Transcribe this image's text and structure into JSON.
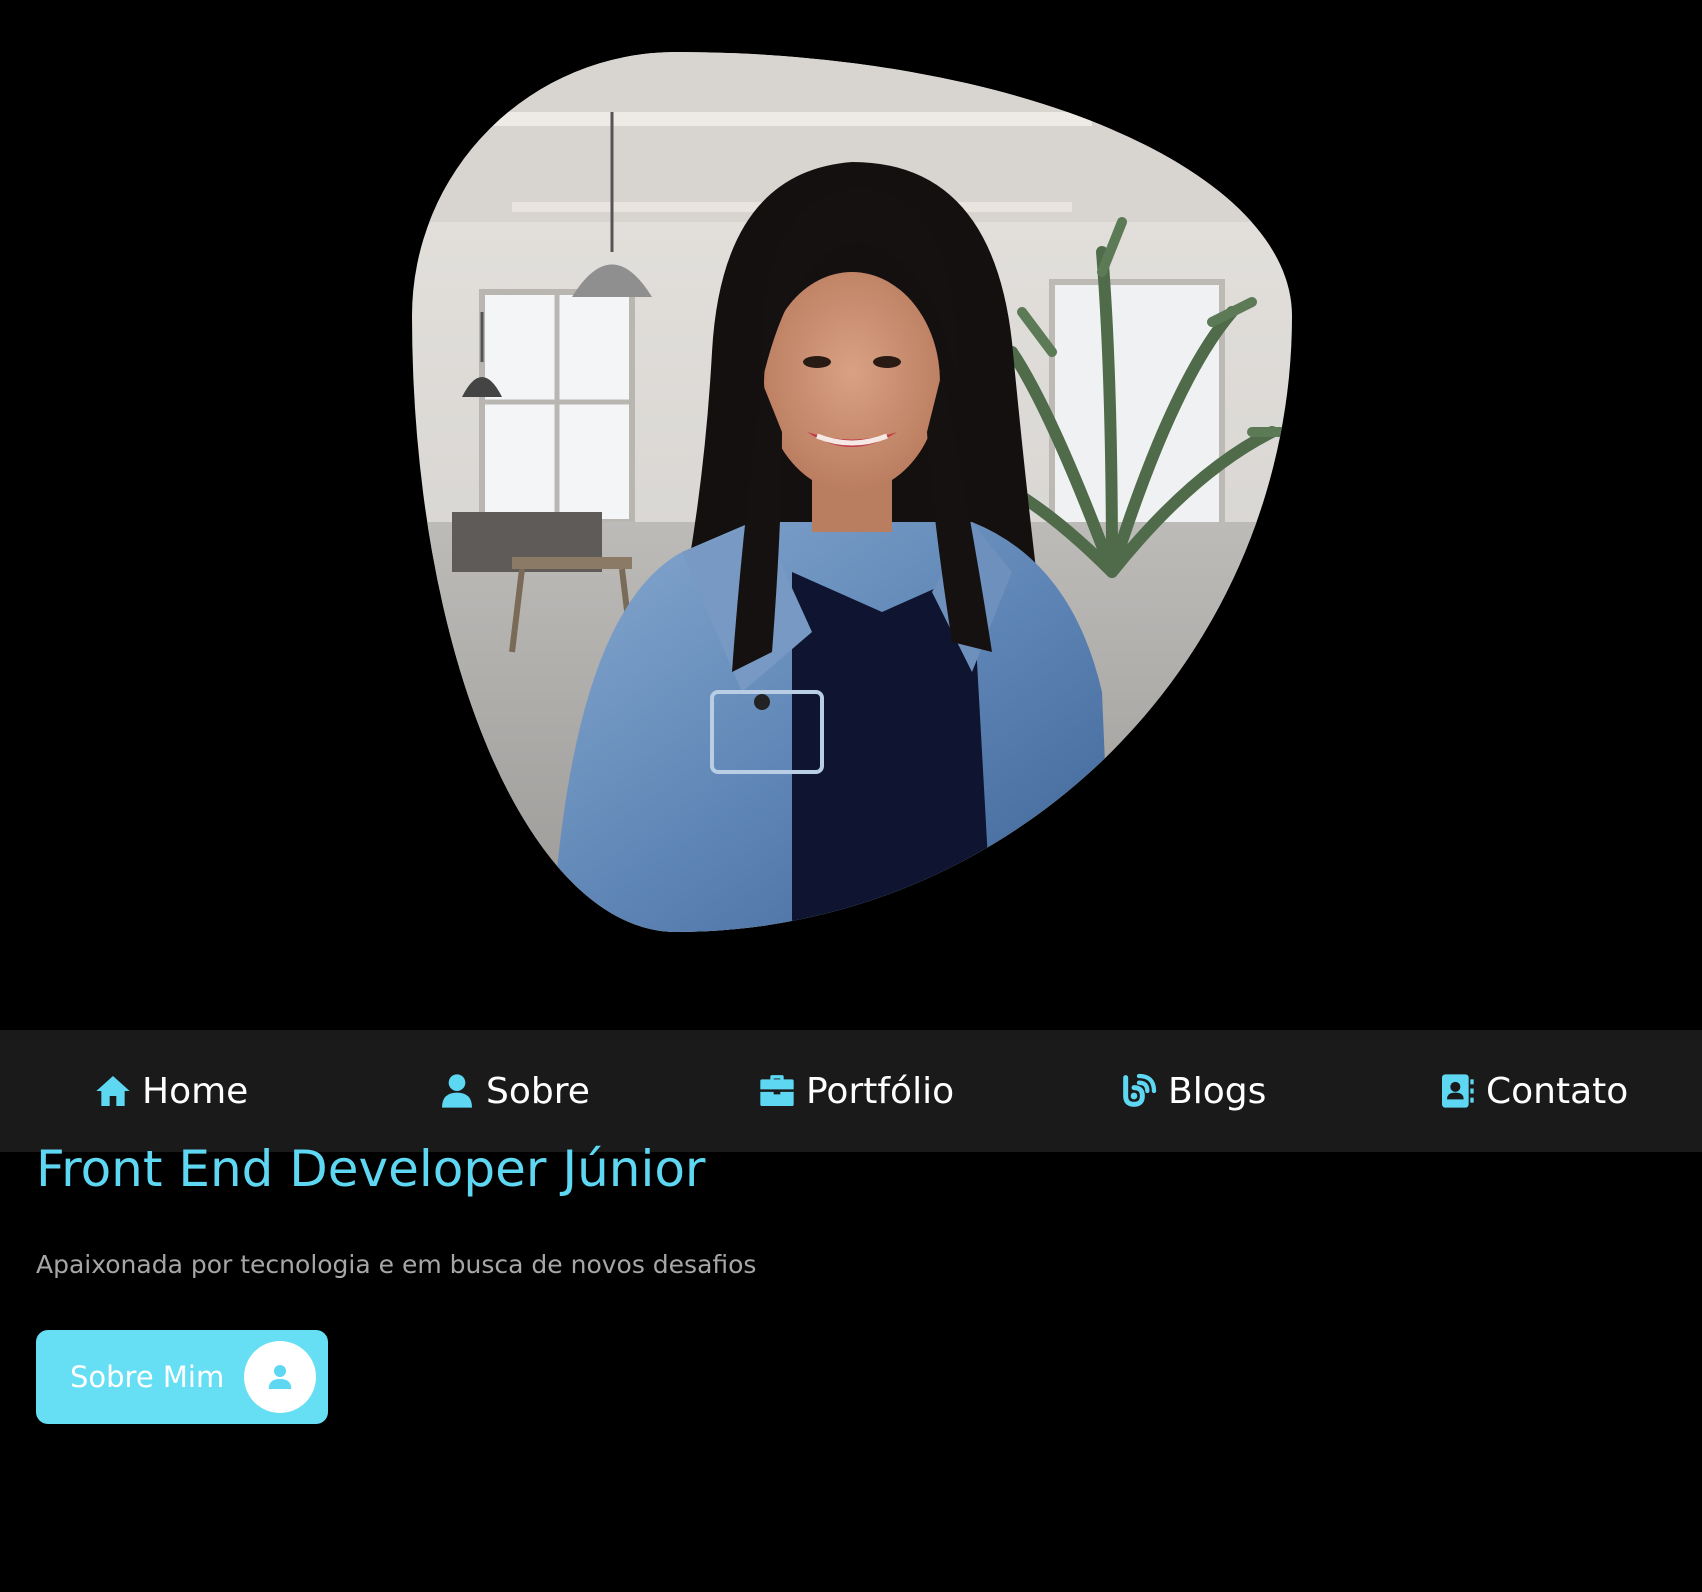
{
  "hero": {
    "photo_alt": "",
    "role_title": "Front End Developer Júnior",
    "tagline": "Apaixonada por tecnologia e em busca de novos desafios",
    "cta": {
      "label": "Sobre Mim",
      "icon": "user-icon"
    }
  },
  "nav": {
    "items": [
      {
        "label": "Home",
        "icon": "home-icon"
      },
      {
        "label": "Sobre",
        "icon": "user-icon"
      },
      {
        "label": "Portfólio",
        "icon": "briefcase-icon"
      },
      {
        "label": "Blogs",
        "icon": "blog-icon"
      },
      {
        "label": "Contato",
        "icon": "contact-book-icon"
      }
    ]
  },
  "colors": {
    "background": "#000000",
    "navbar": "#1a1a1a",
    "accent": "#5ed7f2",
    "button": "#66dff5",
    "tagline": "#a6a6a6",
    "nav_text": "#ffffff"
  }
}
